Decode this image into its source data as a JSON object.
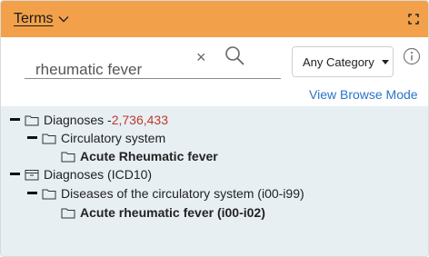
{
  "header": {
    "title": "Terms"
  },
  "search": {
    "value": "rheumatic fever",
    "clear_glyph": "×",
    "category_label": "Any Category",
    "browse_mode_label": "View Browse Mode"
  },
  "tree": {
    "nodes": [
      {
        "label": "Diagnoses - ",
        "count": "2,736,433",
        "level": 0,
        "expanded": true
      },
      {
        "label": "Circulatory system",
        "level": 1,
        "expanded": true
      },
      {
        "label": "Acute Rheumatic fever",
        "level": 2,
        "bold": true
      },
      {
        "label": "Diagnoses (ICD10)",
        "level": 0,
        "expanded": true,
        "icon": "archive-icon"
      },
      {
        "label": "Diseases of the circulatory system (i00-i99)",
        "level": 1,
        "expanded": true
      },
      {
        "label": "Acute rheumatic fever (i00-i02)",
        "level": 2,
        "bold": true
      }
    ]
  },
  "colors": {
    "header_bg": "#f2a14a",
    "tree_bg": "#e7eff3",
    "link": "#2a74c9",
    "count": "#c0392b"
  }
}
